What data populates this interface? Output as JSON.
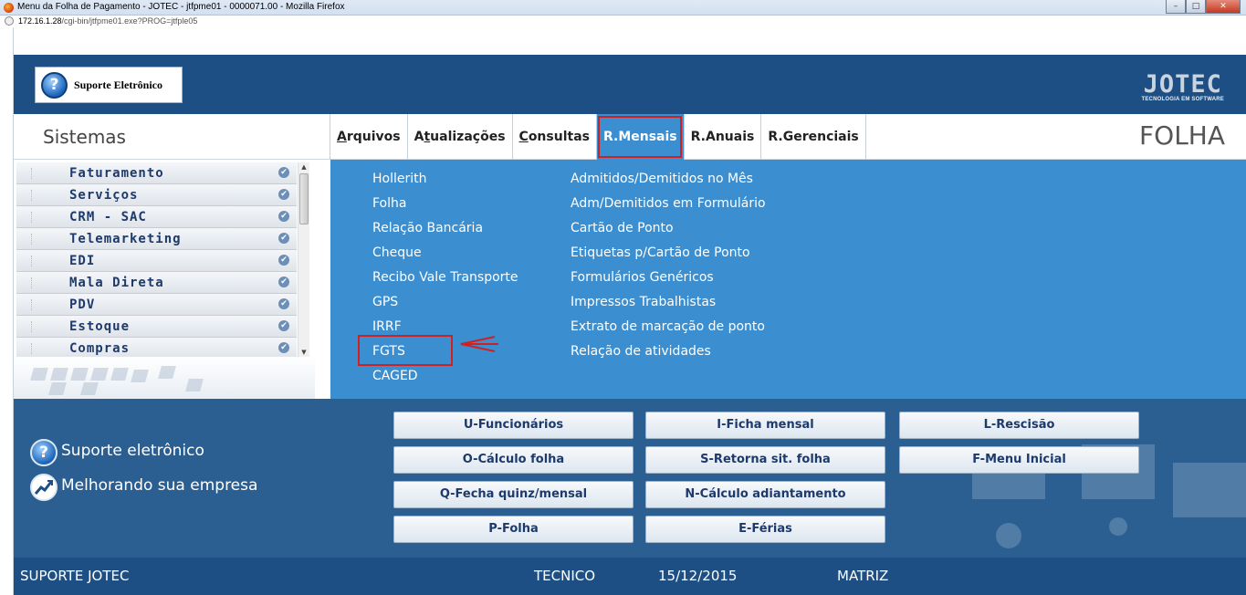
{
  "browser": {
    "window_title": "Menu da Folha de Pagamento - JOTEC - jtfpme01 - 0000071.00 - Mozilla Firefox",
    "url_host": "172.16.1.28",
    "url_path": "/cgi-bin/jtfpme01.exe?PROG=jtfple05",
    "window_buttons": [
      "–",
      "□",
      "✕"
    ]
  },
  "header": {
    "support_label": "Suporte Eletrônico",
    "logo_text": "JOTEC",
    "logo_tagline": "TECNOLOGIA EM SOFTWARE"
  },
  "menubar": {
    "sistemas_label": "Sistemas",
    "tabs": [
      {
        "hotkey": "A",
        "rest": "rquivos"
      },
      {
        "pre": "A",
        "hotkey": "t",
        "rest": "ualizações"
      },
      {
        "hotkey": "C",
        "rest": "onsultas"
      },
      {
        "label": "R.Mensais",
        "active": true
      },
      {
        "label": "R.Anuais"
      },
      {
        "label": "R.Gerenciais"
      }
    ],
    "module_title": "FOLHA"
  },
  "sidebar": {
    "items": [
      {
        "label": "Faturamento"
      },
      {
        "label": "Serviços"
      },
      {
        "label": "CRM - SAC"
      },
      {
        "label": "Telemarketing"
      },
      {
        "label": "EDI"
      },
      {
        "label": "Mala Direta"
      },
      {
        "label": "PDV"
      },
      {
        "label": "Estoque"
      },
      {
        "label": "Compras"
      }
    ]
  },
  "dropdown": {
    "col1": [
      "Hollerith",
      "Folha",
      "Relação Bancária",
      "Cheque",
      "Recibo Vale Transporte",
      "GPS",
      "IRRF",
      "FGTS",
      "CAGED"
    ],
    "col2": [
      "Admitidos/Demitidos no Mês",
      "Adm/Demitidos em Formulário",
      "Cartão de Ponto",
      "Etiquetas p/Cartão de Ponto",
      "Formulários Genéricos",
      "Impressos Trabalhistas",
      "Extrato de marcação de ponto",
      "Relação de atividades"
    ]
  },
  "bottom": {
    "info1": "Suporte eletrônico",
    "info2": "Melhorando sua empresa",
    "buttons": [
      "U-Funcionários",
      "I-Ficha mensal",
      "L-Rescisão",
      "O-Cálculo folha",
      "S-Retorna sit. folha",
      "F-Menu Inicial",
      "Q-Fecha quinz/mensal",
      "N-Cálculo adiantamento",
      "P-Folha",
      "E-Férias"
    ]
  },
  "statusbar": {
    "user_group": "SUPORTE JOTEC",
    "user": "TECNICO",
    "date": "15/12/2015",
    "branch": "MATRIZ"
  },
  "colors": {
    "header_bg": "#1e4f84",
    "dropdown_bg": "#3b8ed0",
    "highlight": "#d02020"
  }
}
